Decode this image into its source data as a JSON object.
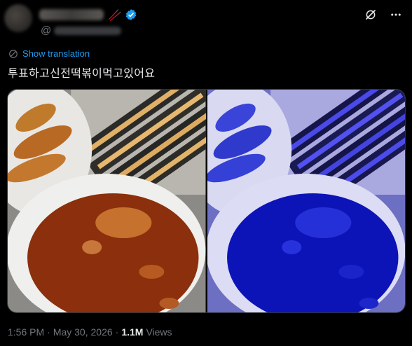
{
  "author": {
    "handle_prefix": "@",
    "name_emoji": "🥢",
    "verified_icon": "verified-badge-icon"
  },
  "header_actions": {
    "grok_icon": "grok-icon",
    "more_icon": "more-options-icon"
  },
  "translation": {
    "label": "Show translation",
    "icon": "translate-globe-icon"
  },
  "tweet": {
    "text": "투표하고신전떡볶이먹고있어요"
  },
  "media": {
    "photos": [
      {
        "description_name": "tteokbokki-original-photo"
      },
      {
        "description_name": "tteokbokki-blue-filtered-photo"
      }
    ]
  },
  "meta": {
    "time": "1:56 PM",
    "separator1": "·",
    "date": "May 30, 2026",
    "separator2": "·",
    "views_count": "1.1M",
    "views_label": "Views"
  },
  "colors": {
    "background": "#000000",
    "accent": "#1d9bf0",
    "secondary_text": "#71767b",
    "primary_text": "#e7e9ea"
  }
}
